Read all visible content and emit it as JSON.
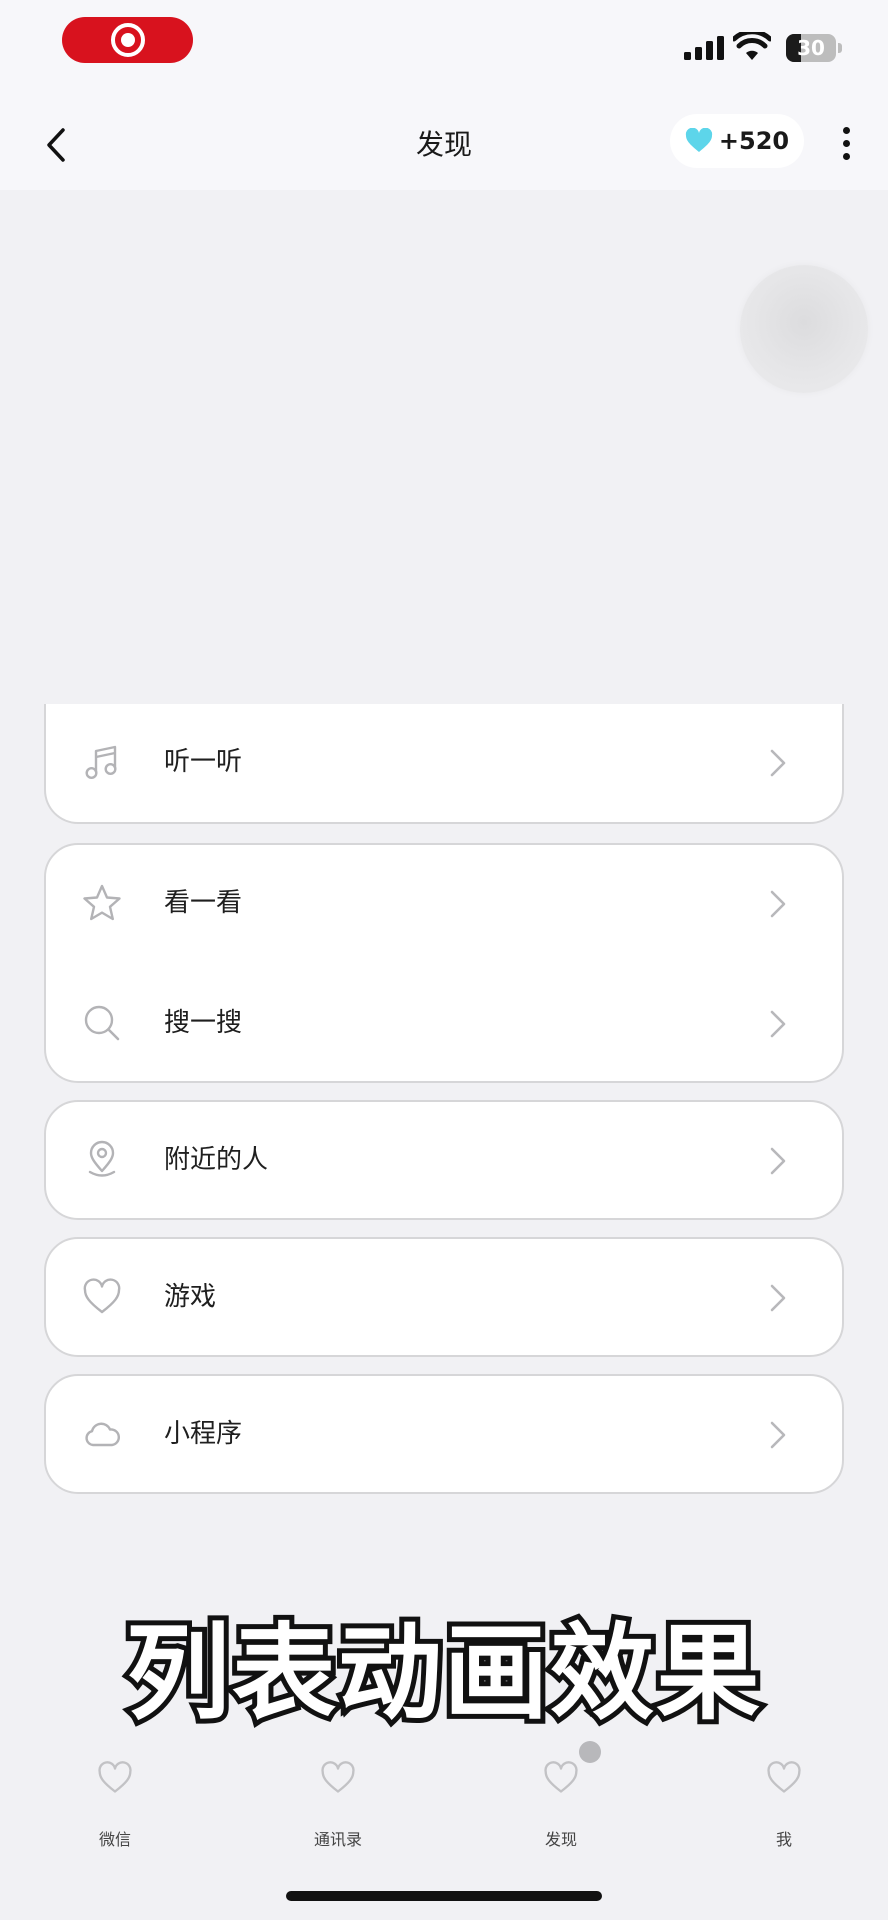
{
  "status_bar": {
    "battery_text": "30",
    "battery_level": 0.3,
    "recording_color": "#d8121e"
  },
  "nav": {
    "title": "发现",
    "points": "+520",
    "back_icon": "chevron-left-icon",
    "more_icon": "more-vertical-icon",
    "points_icon": "heart-icon",
    "points_icon_color": "#5dd5ea"
  },
  "menu": {
    "cards": [
      {
        "items": [
          {
            "label": "听一听",
            "icon": "music-note-icon"
          }
        ]
      },
      {
        "items": [
          {
            "label": "看一看",
            "icon": "star-icon"
          },
          {
            "label": "搜一搜",
            "icon": "search-icon"
          }
        ]
      },
      {
        "items": [
          {
            "label": "附近的人",
            "icon": "location-pin-icon"
          }
        ]
      },
      {
        "items": [
          {
            "label": "游戏",
            "icon": "heart-icon"
          }
        ]
      },
      {
        "items": [
          {
            "label": "小程序",
            "icon": "cloud-icon"
          }
        ]
      }
    ]
  },
  "caption": "列表动画效果",
  "tabs": [
    {
      "label": "微信",
      "icon": "heart-icon"
    },
    {
      "label": "通讯录",
      "icon": "heart-icon"
    },
    {
      "label": "发现",
      "icon": "heart-icon"
    },
    {
      "label": "我",
      "icon": "heart-icon"
    }
  ],
  "colors": {
    "background": "#f1f1f4",
    "card": "#ffffff",
    "card_border": "#d6d6d8",
    "icon_gray": "#b3b3b6"
  }
}
